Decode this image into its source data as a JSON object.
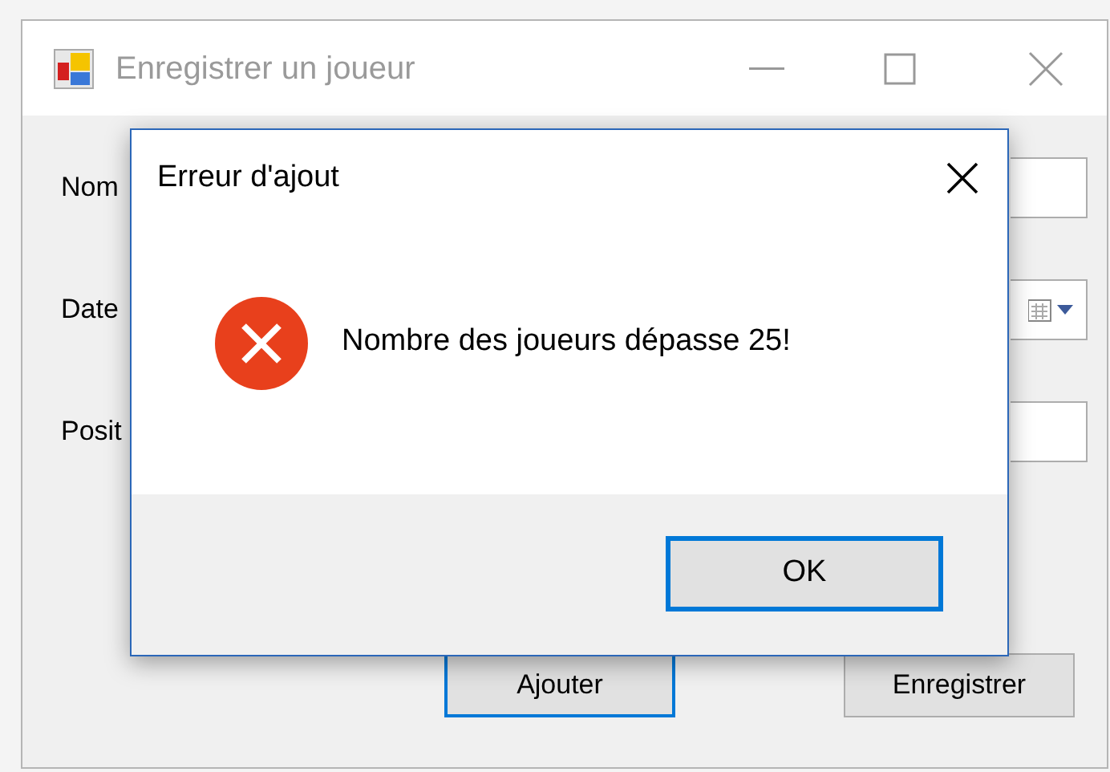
{
  "window": {
    "title": "Enregistrer un joueur",
    "active": false
  },
  "form": {
    "fields": [
      {
        "label": "Nom",
        "kind": "text"
      },
      {
        "label": "Date",
        "kind": "date"
      },
      {
        "label": "Posit",
        "kind": "text"
      }
    ],
    "buttons": [
      {
        "label": "Ajouter",
        "focused": true
      },
      {
        "label": "Enregistrer",
        "focused": false
      }
    ]
  },
  "dialog": {
    "title": "Erreur d'ajout",
    "message": "Nombre des joueurs dépasse 25!",
    "kind": "error",
    "buttons": [
      {
        "label": "OK",
        "focused": true
      }
    ]
  }
}
